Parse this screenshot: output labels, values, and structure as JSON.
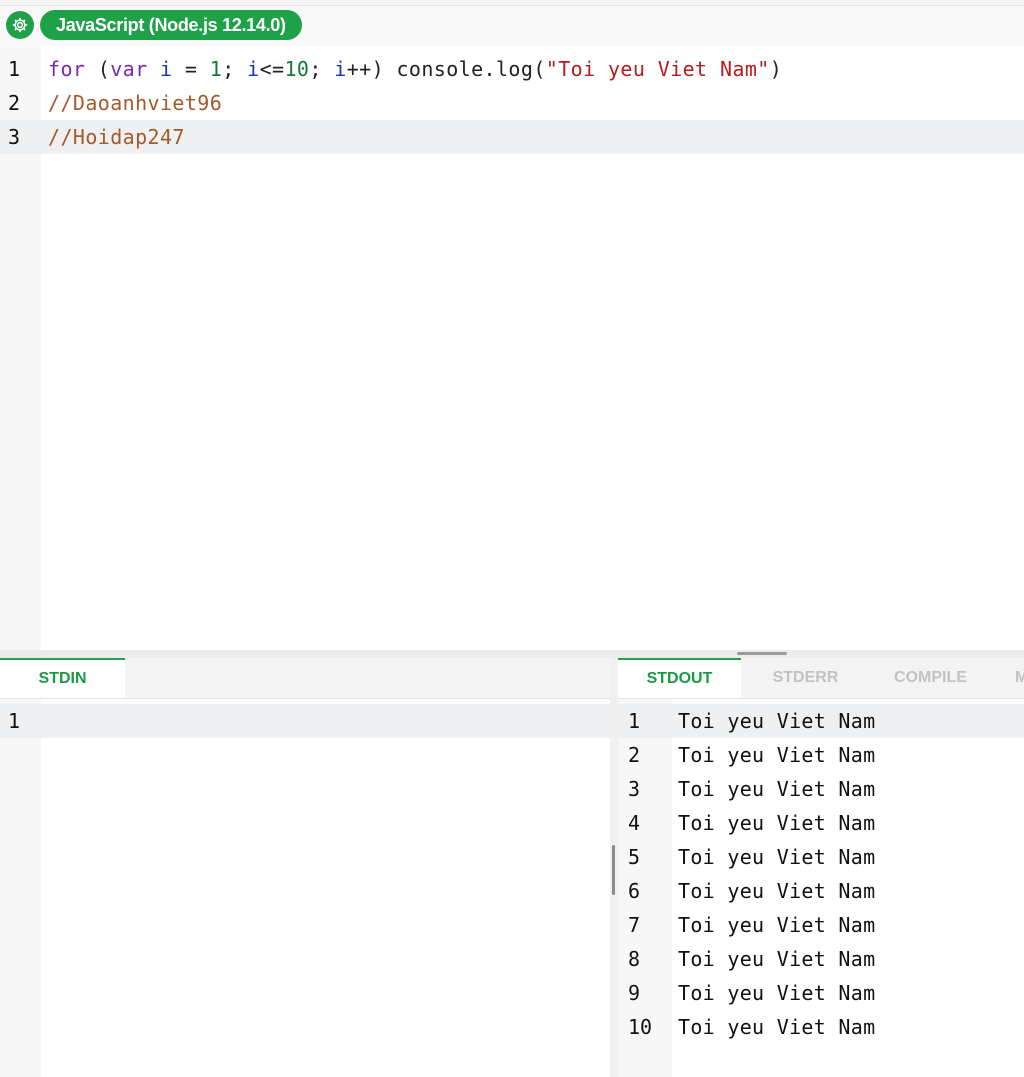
{
  "header": {
    "settings_icon": "gear-icon",
    "language": "JavaScript (Node.js 12.14.0)",
    "accent": "#1fa14a"
  },
  "editor": {
    "lines": [
      {
        "number": "1",
        "tokens": [
          {
            "t": "for",
            "c": "kw"
          },
          {
            "t": " (",
            "c": ""
          },
          {
            "t": "var",
            "c": "kw"
          },
          {
            "t": " ",
            "c": ""
          },
          {
            "t": "i",
            "c": "var"
          },
          {
            "t": " = ",
            "c": ""
          },
          {
            "t": "1",
            "c": "num"
          },
          {
            "t": "; ",
            "c": ""
          },
          {
            "t": "i",
            "c": "var"
          },
          {
            "t": "<=",
            "c": ""
          },
          {
            "t": "10",
            "c": "num"
          },
          {
            "t": "; ",
            "c": ""
          },
          {
            "t": "i",
            "c": "var"
          },
          {
            "t": "++) console.log(",
            "c": ""
          },
          {
            "t": "\"Toi yeu Viet Nam\"",
            "c": "str"
          },
          {
            "t": ")",
            "c": ""
          }
        ]
      },
      {
        "number": "2",
        "tokens": [
          {
            "t": "//Daoanhviet96",
            "c": "com"
          }
        ]
      },
      {
        "number": "3",
        "tokens": [
          {
            "t": "//Hoidap247",
            "c": "com"
          }
        ]
      }
    ],
    "active_line": 3
  },
  "stdin": {
    "tab_label": "STDIN",
    "lines": [
      {
        "number": "1",
        "text": ""
      }
    ]
  },
  "output": {
    "tabs": [
      {
        "label": "STDOUT",
        "active": true
      },
      {
        "label": "STDERR",
        "active": false
      },
      {
        "label": "COMPILE",
        "active": false
      },
      {
        "label": "M",
        "active": false
      }
    ],
    "lines": [
      {
        "number": "1",
        "text": "Toi yeu Viet Nam"
      },
      {
        "number": "2",
        "text": "Toi yeu Viet Nam"
      },
      {
        "number": "3",
        "text": "Toi yeu Viet Nam"
      },
      {
        "number": "4",
        "text": "Toi yeu Viet Nam"
      },
      {
        "number": "5",
        "text": "Toi yeu Viet Nam"
      },
      {
        "number": "6",
        "text": "Toi yeu Viet Nam"
      },
      {
        "number": "7",
        "text": "Toi yeu Viet Nam"
      },
      {
        "number": "8",
        "text": "Toi yeu Viet Nam"
      },
      {
        "number": "9",
        "text": "Toi yeu Viet Nam"
      },
      {
        "number": "10",
        "text": "Toi yeu Viet Nam"
      }
    ]
  }
}
